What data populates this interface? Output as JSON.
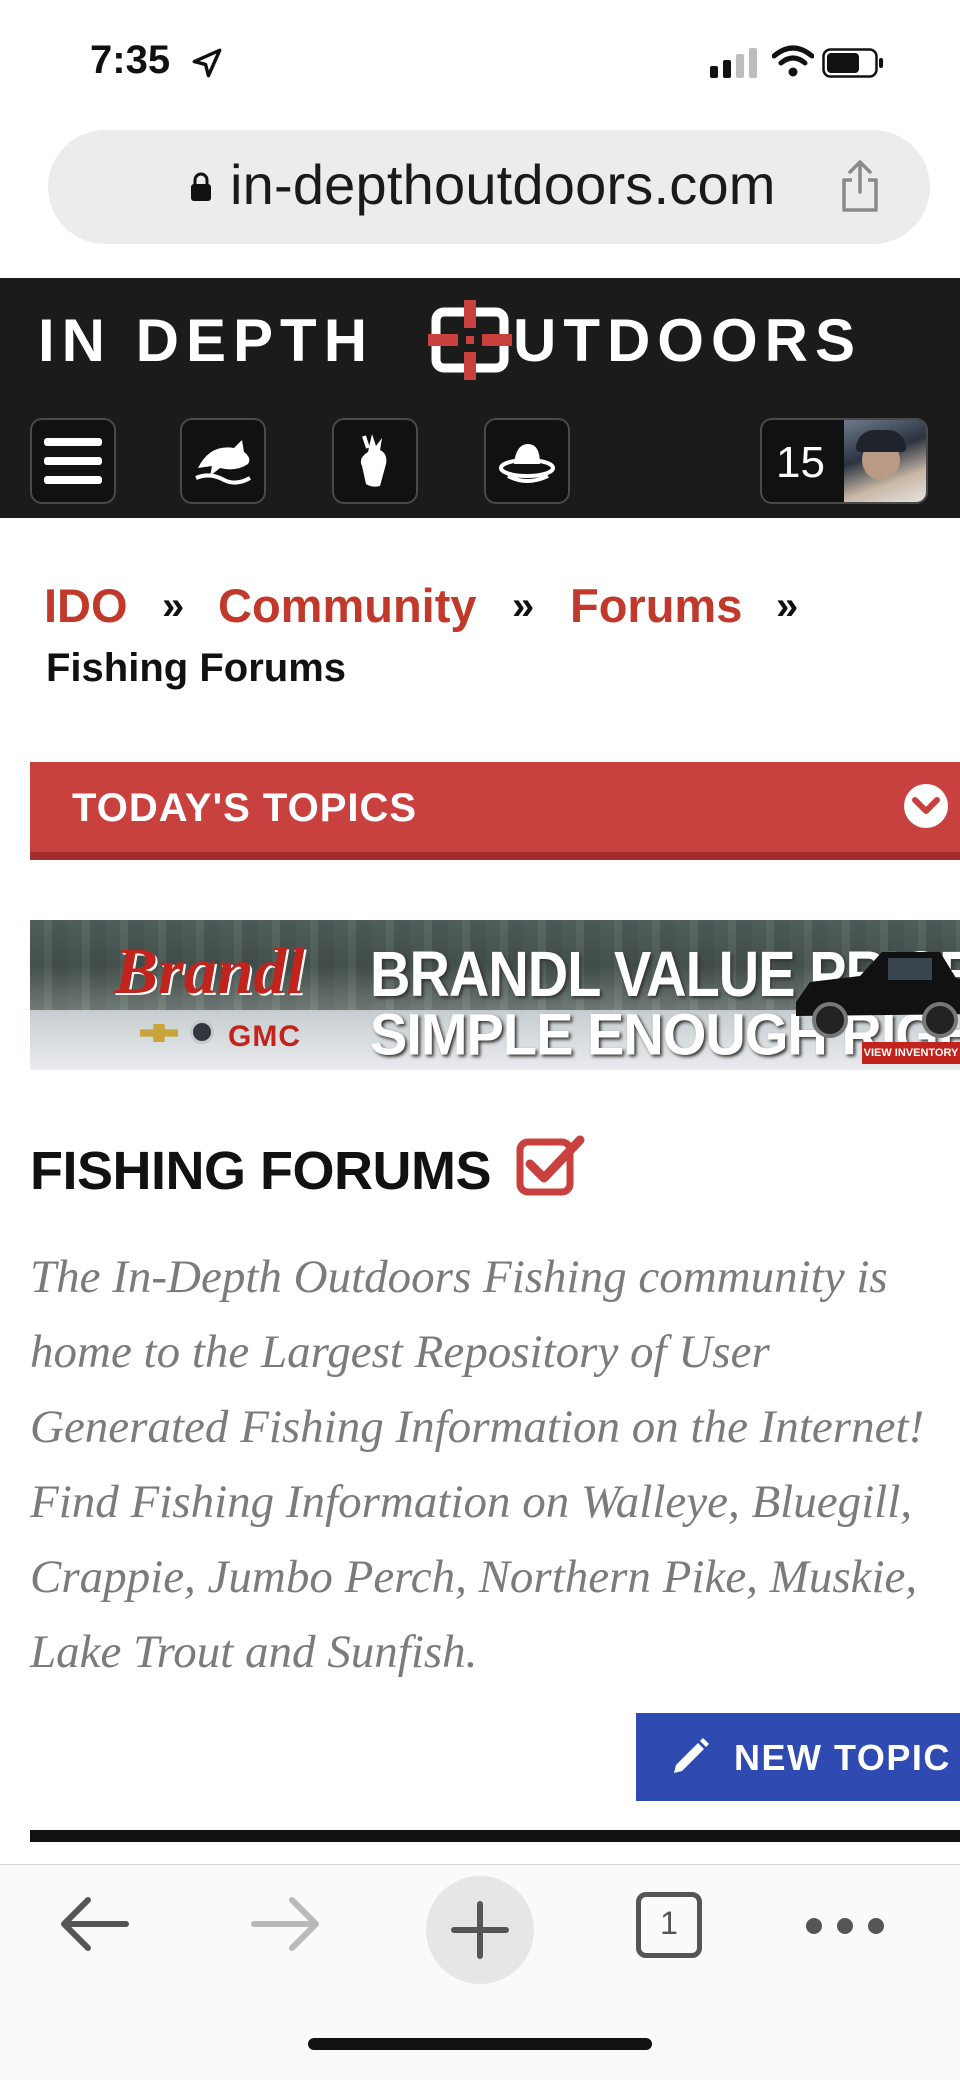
{
  "status_bar": {
    "time": "7:35"
  },
  "browser": {
    "url": "in-depthoutdoors.com",
    "tab_count": "1"
  },
  "site": {
    "logo_left": "IN DEPTH",
    "logo_right": "UTDOORS",
    "notification_count": "15"
  },
  "breadcrumb": {
    "items": [
      "IDO",
      "Community",
      "Forums"
    ],
    "separator": "»",
    "current": "Fishing Forums"
  },
  "topics_bar": {
    "label": "TODAY'S TOPICS"
  },
  "ad": {
    "brand": "Brandl",
    "make": "GMC",
    "headline_1": "BRANDL VALUE PRICE,",
    "headline_2": "SIMPLE ENOUGH RIGHT?",
    "cta": "VIEW INVENTORY"
  },
  "page": {
    "title": "FISHING FORUMS",
    "description": "The In-Depth Outdoors Fishing community is home to the Largest Repository of User Generated Fishing Information on the Internet! Find Fishing Information on Walleye, Bluegill, Crappie, Jumbo Perch, Northern Pike, Muskie, Lake Trout and Sunfish.",
    "new_topic_label": "NEW TOPIC"
  },
  "colors": {
    "accent_red": "#c8413e",
    "link_red": "#c0392b",
    "button_blue": "#2f4ab0",
    "header_bg": "#1b1b1b"
  },
  "icons": [
    "location-arrow-icon",
    "signal-icon",
    "wifi-icon",
    "battery-icon",
    "lock-icon",
    "share-icon",
    "menu-icon",
    "fish-icon",
    "deer-icon",
    "hat-icon",
    "chevron-down-icon",
    "checkbox-checked-icon",
    "pencil-icon",
    "back-arrow-icon",
    "forward-arrow-icon",
    "plus-icon",
    "tabs-icon",
    "more-icon"
  ]
}
